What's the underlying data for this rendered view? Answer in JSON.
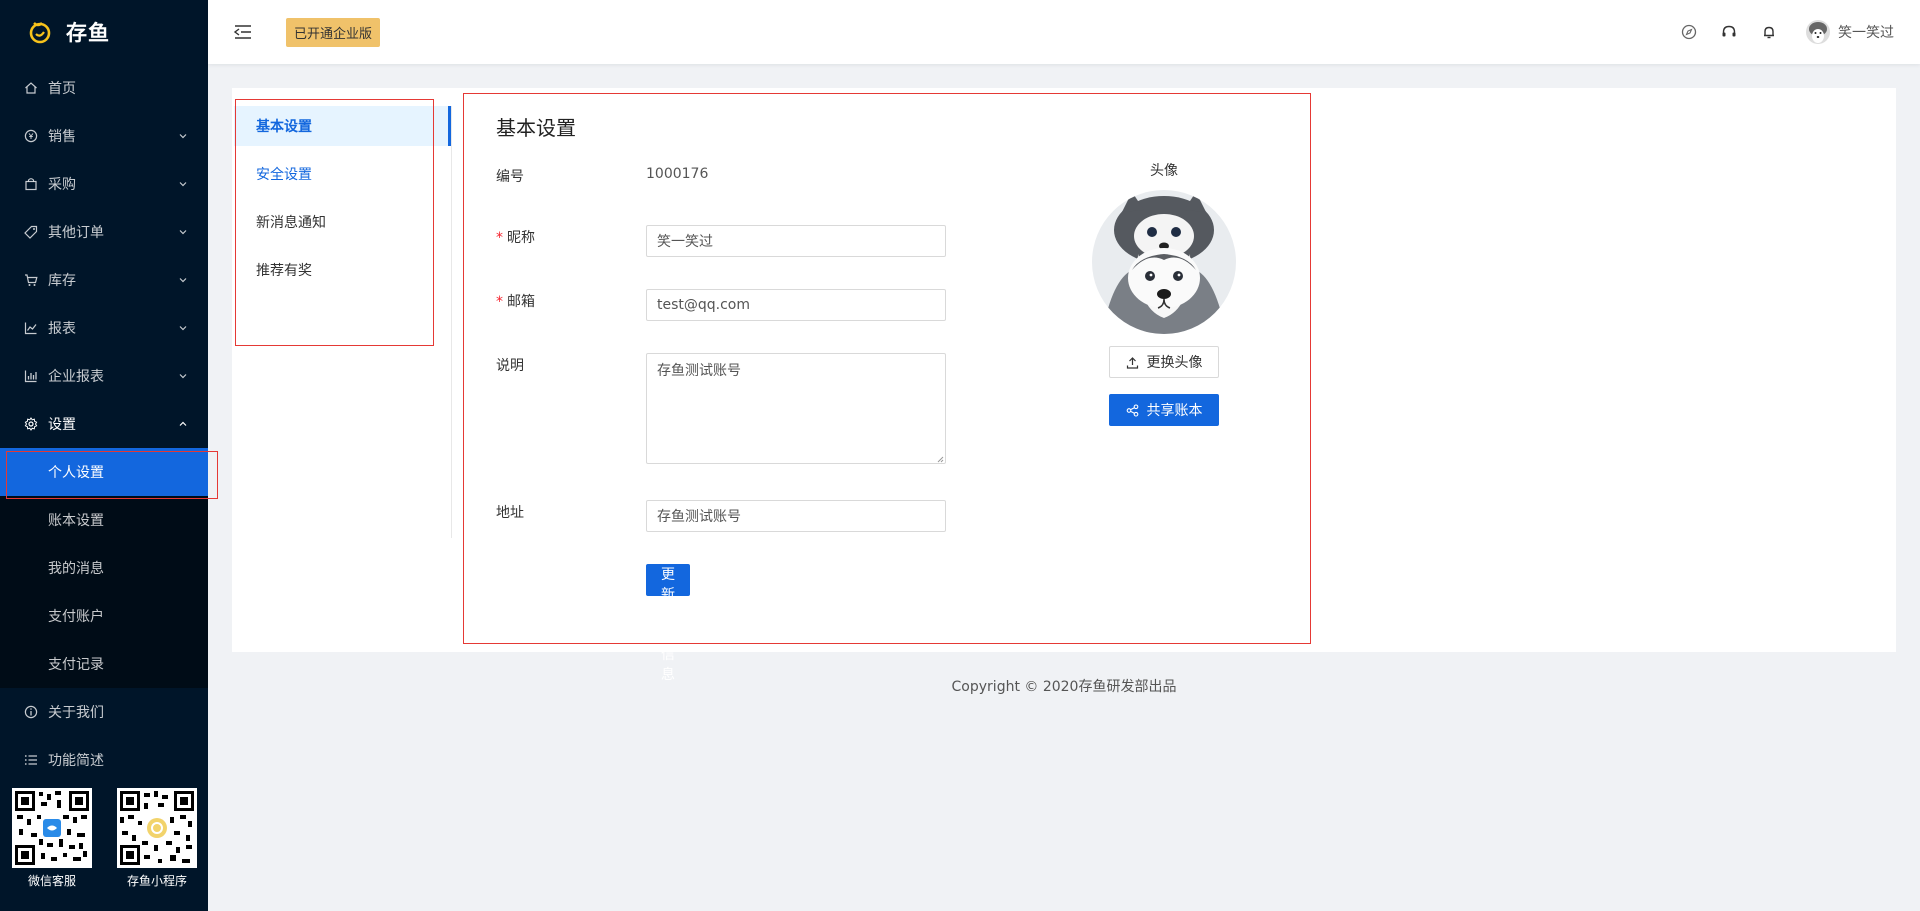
{
  "app": {
    "name": "存鱼"
  },
  "sidebar": {
    "items": [
      {
        "label": "首页",
        "icon": "home-icon"
      },
      {
        "label": "销售",
        "icon": "yen-circle-icon"
      },
      {
        "label": "采购",
        "icon": "shopping-bag-icon"
      },
      {
        "label": "其他订单",
        "icon": "tag-icon"
      },
      {
        "label": "库存",
        "icon": "cart-icon"
      },
      {
        "label": "报表",
        "icon": "line-chart-icon"
      },
      {
        "label": "企业报表",
        "icon": "bar-chart-icon"
      },
      {
        "label": "设置",
        "icon": "gear-icon"
      }
    ],
    "settings_sub": [
      {
        "label": "个人设置",
        "active": true
      },
      {
        "label": "账本设置"
      },
      {
        "label": "我的消息"
      },
      {
        "label": "支付账户"
      },
      {
        "label": "支付记录"
      }
    ],
    "bottom_items": [
      {
        "label": "关于我们",
        "icon": "info-icon"
      },
      {
        "label": "功能简述",
        "icon": "list-icon"
      }
    ],
    "qr": [
      {
        "label": "微信客服"
      },
      {
        "label": "存鱼小程序"
      }
    ]
  },
  "header": {
    "vip_tag": "已开通企业版",
    "user_name": "笑一笑过",
    "icons": [
      "compass-icon",
      "headset-icon",
      "bell-icon"
    ]
  },
  "settings_nav": [
    {
      "label": "基本设置",
      "active": true
    },
    {
      "label": "安全设置"
    },
    {
      "label": "新消息通知"
    },
    {
      "label": "推荐有奖"
    }
  ],
  "form": {
    "title": "基本设置",
    "id_label": "编号",
    "id_value": "1000176",
    "nickname_label": "昵称",
    "nickname_value": "笑一笑过",
    "email_label": "邮箱",
    "email_value": "test@qq.com",
    "desc_label": "说明",
    "desc_value": "存鱼测试账号",
    "address_label": "地址",
    "address_value": "存鱼测试账号",
    "submit_label": "更新基本信息"
  },
  "avatar_panel": {
    "title": "头像",
    "change_label": "更换头像",
    "share_label": "共享账本"
  },
  "footer": {
    "text": "Copyright © 2020存鱼研发部出品"
  },
  "colors": {
    "sidebar_bg": "#001529",
    "primary": "#1367de",
    "vip": "#f0c26a",
    "annotation": "#e53935"
  }
}
